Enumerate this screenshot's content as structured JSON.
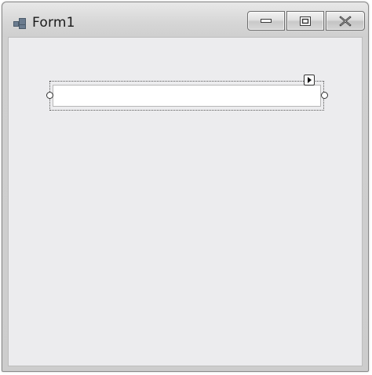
{
  "window": {
    "title": "Form1",
    "icon": "form-icon"
  },
  "caption_buttons": {
    "minimize_icon": "minimize-icon",
    "maximize_icon": "maximize-icon",
    "close_icon": "close-icon"
  },
  "form": {
    "textbox_value": "",
    "selected_control": "textbox",
    "smart_tag_icon": "smart-tag-arrow-icon"
  },
  "colors": {
    "client_background": "#ececee",
    "textbox_background": "#ffffff"
  }
}
